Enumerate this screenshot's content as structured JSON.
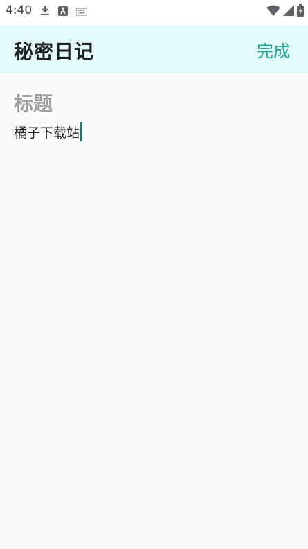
{
  "status_bar": {
    "time": "4:40",
    "icons_left": [
      "download-icon",
      "sim-alert-icon",
      "keyboard-icon"
    ],
    "icons_right": [
      "wifi-icon",
      "signal-icon",
      "battery-charging-icon"
    ]
  },
  "app_bar": {
    "title": "秘密日记",
    "done_label": "完成"
  },
  "editor": {
    "title_placeholder": "标题",
    "content": "橘子下载站"
  },
  "colors": {
    "app_bar_bg": "#e4fbfd",
    "accent": "#19a88f",
    "caret": "#1b7a6f"
  }
}
